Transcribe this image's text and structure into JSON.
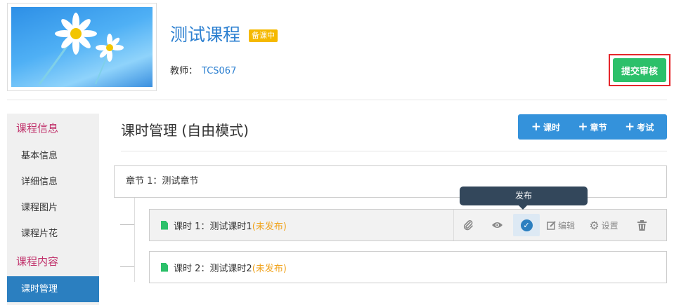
{
  "course": {
    "title": "测试课程",
    "status": "备课中",
    "teacher_label": "教师：",
    "teacher_name": "TCS067",
    "submit_label": "提交审核"
  },
  "sidebar": {
    "groups": [
      {
        "label": "课程信息",
        "items": [
          "基本信息",
          "详细信息",
          "课程图片",
          "课程片花"
        ]
      },
      {
        "label": "课程内容",
        "items": [
          "课时管理"
        ]
      }
    ],
    "active_item": "课时管理"
  },
  "main": {
    "title": "课时管理 (自由模式)",
    "toolbar": {
      "lesson": "课时",
      "chapter": "章节",
      "exam": "考试"
    },
    "chapter": {
      "label": "章节 1：",
      "name": "测试章节"
    },
    "lessons": [
      {
        "label": "课时 1：",
        "name": "测试课时1",
        "status": "(未发布)"
      },
      {
        "label": "课时 2：",
        "name": "测试课时2",
        "status": "(未发布)"
      }
    ],
    "actions": {
      "edit": "编辑",
      "settings": "设置"
    },
    "tooltip": "发布"
  },
  "colors": {
    "accent_blue": "#2b7fc0",
    "submit_green": "#2cc06a",
    "status_badge": "#f5b900",
    "unpublished": "#f0a21a",
    "sidebar_group": "#c0306a",
    "highlight_red": "#e5262b"
  }
}
